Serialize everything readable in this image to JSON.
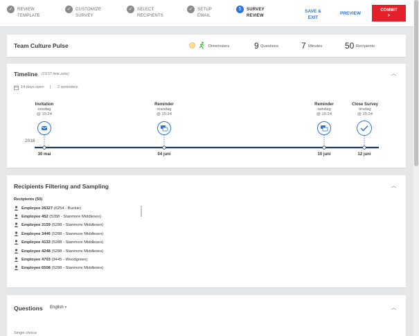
{
  "steps": [
    {
      "label1": "REVIEW",
      "label2": "TEMPLATE",
      "state": "done"
    },
    {
      "label1": "CUSTOMIZE",
      "label2": "SURVEY",
      "state": "done"
    },
    {
      "label1": "SELECT",
      "label2": "RECIPIENTS",
      "state": "done"
    },
    {
      "label1": "SETUP",
      "label2": "EMAIL",
      "state": "done"
    },
    {
      "label1": "SURVEY",
      "label2": "REVIEW",
      "state": "active",
      "number": "5"
    }
  ],
  "header_actions": {
    "save_exit_1": "SAVE &",
    "save_exit_2": "EXIT",
    "preview": "PREVIEW",
    "commit": "COMMIT",
    "commit_arrow": ">"
  },
  "summary": {
    "title": "Team Culture Pulse",
    "dimensions_label": "Dimensions",
    "questions_value": "9",
    "questions_label": "Questions",
    "minutes_value": "7",
    "minutes_label": "Minutes",
    "recipients_value": "50",
    "recipients_label": "Recipients"
  },
  "timeline": {
    "title": "Timeline",
    "timezone": "(CEST time zone)",
    "days_open": "14 days open",
    "separator": "|",
    "reminders": "2 reminders",
    "year": "2018",
    "events": [
      {
        "name": "Invitation",
        "day": "onsdag",
        "time": "@ 15:24",
        "date": "30 mai",
        "icon": "mail-icon"
      },
      {
        "name": "Reminder",
        "day": "mandag",
        "time": "@ 15:24",
        "date": "04 juni",
        "icon": "reminder-icon"
      },
      {
        "name": "Reminder",
        "day": "søndag",
        "time": "@ 15:24",
        "date": "10 juni",
        "icon": "reminder-icon"
      },
      {
        "name": "Close Survey",
        "day": "tirsdag",
        "time": "@ 15:24",
        "date": "12 juni",
        "icon": "check-icon"
      }
    ]
  },
  "recipients": {
    "title": "Recipients Filtering and Sampling",
    "subtitle": "Recipients (50)",
    "rows": [
      {
        "name": "Employee 26327",
        "detail": "(6254 - Buckie)"
      },
      {
        "name": "Employee 452",
        "detail": "(5288 - Stanmore Middlesex)"
      },
      {
        "name": "Employee 3159",
        "detail": "(5288 - Stanmore Middlesex)"
      },
      {
        "name": "Employee 3446",
        "detail": "(5288 - Stanmore Middlesex)"
      },
      {
        "name": "Employee 4133",
        "detail": "(5288 - Stanmore Middlesex)"
      },
      {
        "name": "Employee 4248",
        "detail": "(5288 - Stanmore Middlesex)"
      },
      {
        "name": "Employee 4703",
        "detail": "(3445 - Woodgreen)"
      },
      {
        "name": "Employee 6508",
        "detail": "(5288 - Stanmore Middlesex)"
      }
    ]
  },
  "questions": {
    "title": "Questions",
    "language": "English",
    "language_arrow": "▾",
    "first_type": "Single choice"
  },
  "colors": {
    "accent": "#2c73d2",
    "commit": "#e4202a"
  }
}
